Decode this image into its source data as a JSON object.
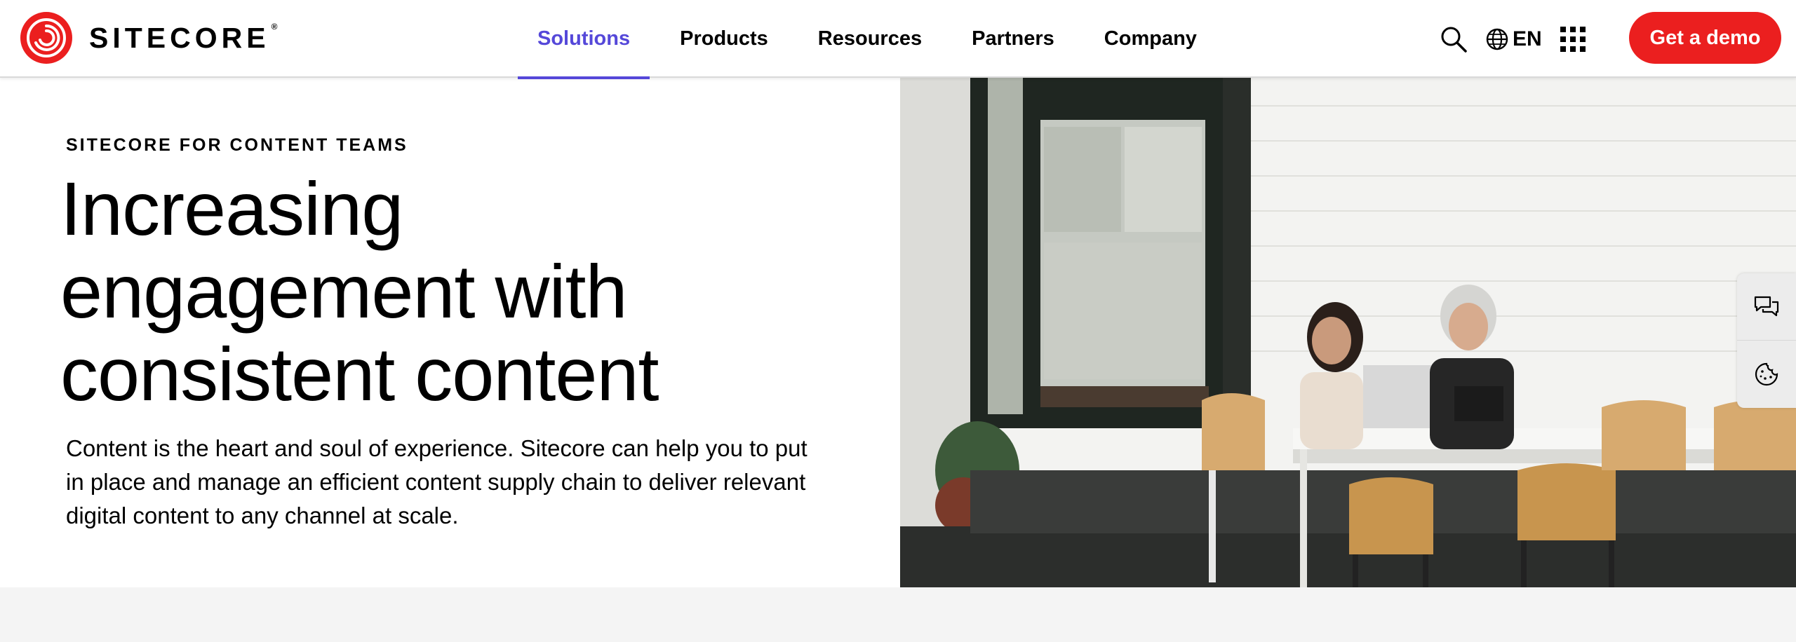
{
  "brand": {
    "name": "SITECORE",
    "registered": "®",
    "color": "#eb1f1f"
  },
  "nav": {
    "items": [
      {
        "label": "Solutions",
        "active": true
      },
      {
        "label": "Products",
        "active": false
      },
      {
        "label": "Resources",
        "active": false
      },
      {
        "label": "Partners",
        "active": false
      },
      {
        "label": "Company",
        "active": false
      }
    ],
    "active_color": "#5548d9"
  },
  "utility": {
    "language": "EN",
    "icons": [
      "search-icon",
      "globe-icon",
      "app-grid-icon"
    ]
  },
  "cta": {
    "label": "Get a demo",
    "color": "#eb1f1f"
  },
  "hero": {
    "eyebrow": "SITECORE FOR CONTENT TEAMS",
    "headline": [
      "Increasing",
      "engagement with",
      "consistent content"
    ],
    "lead": "Content is the heart and soul of experience. Sitecore can help you to put in place and manage an efficient content supply chain to deliver relevant digital content to any channel at scale."
  },
  "side_tools": {
    "icons": [
      "chat-icon",
      "cookie-icon"
    ]
  }
}
